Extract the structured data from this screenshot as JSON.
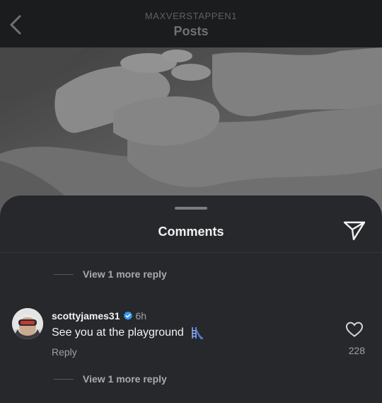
{
  "header": {
    "account": "MAXVERSTAPPEN1",
    "title": "Posts"
  },
  "comments_sheet": {
    "title": "Comments",
    "top_thread": {
      "view_more_label": "View 1 more reply"
    },
    "comment": {
      "username": "scottyjames31",
      "verified": true,
      "time_ago": "6h",
      "text": "See you at the playground",
      "emoji_icon": "playground-slide-icon",
      "reply_label": "Reply",
      "like_count": "228",
      "view_more_label": "View 1 more reply"
    }
  },
  "icons": {
    "back": "chevron-left-icon",
    "share": "paper-plane-icon",
    "like": "heart-outline-icon",
    "verified": "verified-badge-icon"
  },
  "colors": {
    "sheet_background": "#26282b",
    "header_background": "#1b1c1e",
    "verified_blue": "#3797f0",
    "text_primary": "#f2f2f2",
    "text_secondary": "#9ea0a3"
  }
}
